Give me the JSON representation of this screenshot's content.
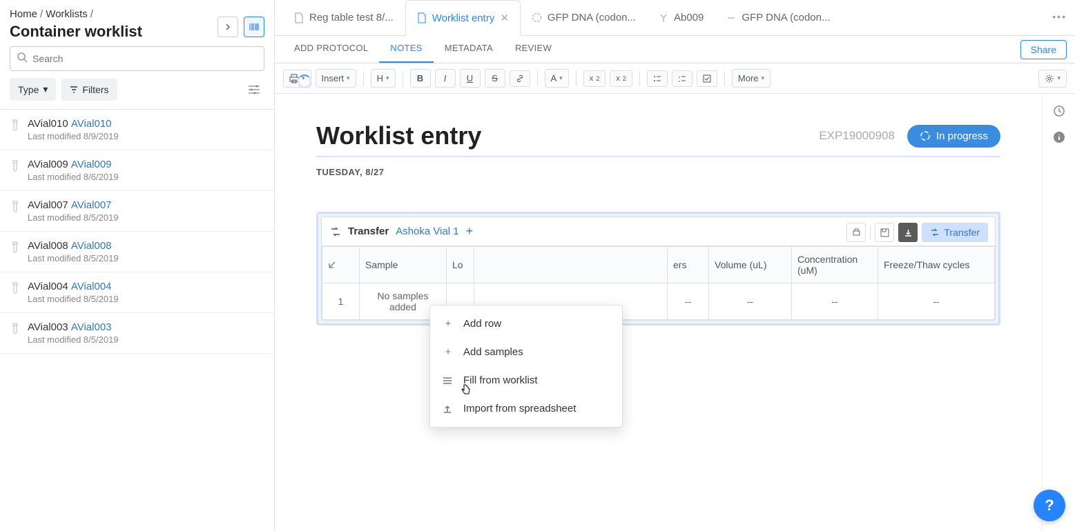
{
  "breadcrumbs": {
    "home": "Home",
    "worklists": "Worklists"
  },
  "sidebar": {
    "title": "Container worklist",
    "search_placeholder": "Search",
    "type_btn": "Type",
    "filters_btn": "Filters",
    "items": [
      {
        "name": "AVial010",
        "alias": "AVial010",
        "modified": "Last modified 8/9/2019"
      },
      {
        "name": "AVial009",
        "alias": "AVial009",
        "modified": "Last modified 8/6/2019"
      },
      {
        "name": "AVial007",
        "alias": "AVial007",
        "modified": "Last modified 8/5/2019"
      },
      {
        "name": "AVial008",
        "alias": "AVial008",
        "modified": "Last modified 8/5/2019"
      },
      {
        "name": "AVial004",
        "alias": "AVial004",
        "modified": "Last modified 8/5/2019"
      },
      {
        "name": "AVial003",
        "alias": "AVial003",
        "modified": "Last modified 8/5/2019"
      }
    ]
  },
  "tabs": [
    {
      "label": "Reg table test 8/..."
    },
    {
      "label": "Worklist entry"
    },
    {
      "label": "GFP DNA (codon..."
    },
    {
      "label": "Ab009"
    },
    {
      "label": "GFP DNA (codon..."
    }
  ],
  "subtabs": {
    "add_protocol": "ADD PROTOCOL",
    "notes": "NOTES",
    "metadata": "METADATA",
    "review": "REVIEW"
  },
  "share": "Share",
  "toolbar": {
    "insert": "Insert",
    "heading": "H",
    "more": "More"
  },
  "doc": {
    "title": "Worklist entry",
    "id": "EXP19000908",
    "status": "In progress",
    "date": "TUESDAY, 8/27"
  },
  "transfer": {
    "title": "Transfer",
    "chip": "Ashoka Vial 1",
    "button": "Transfer",
    "columns": {
      "sample": "Sample",
      "location": "Lo",
      "others": "ers",
      "volume": "Volume (uL)",
      "concentration": "Concentration (uM)",
      "freeze": "Freeze/Thaw cycles"
    },
    "row_num": "1",
    "no_samples": "No samples added",
    "dash": "--"
  },
  "menu": {
    "add_row": "Add row",
    "add_samples": "Add samples",
    "fill_worklist": "Fill from worklist",
    "import_spread": "Import from spreadsheet"
  },
  "help": "?"
}
